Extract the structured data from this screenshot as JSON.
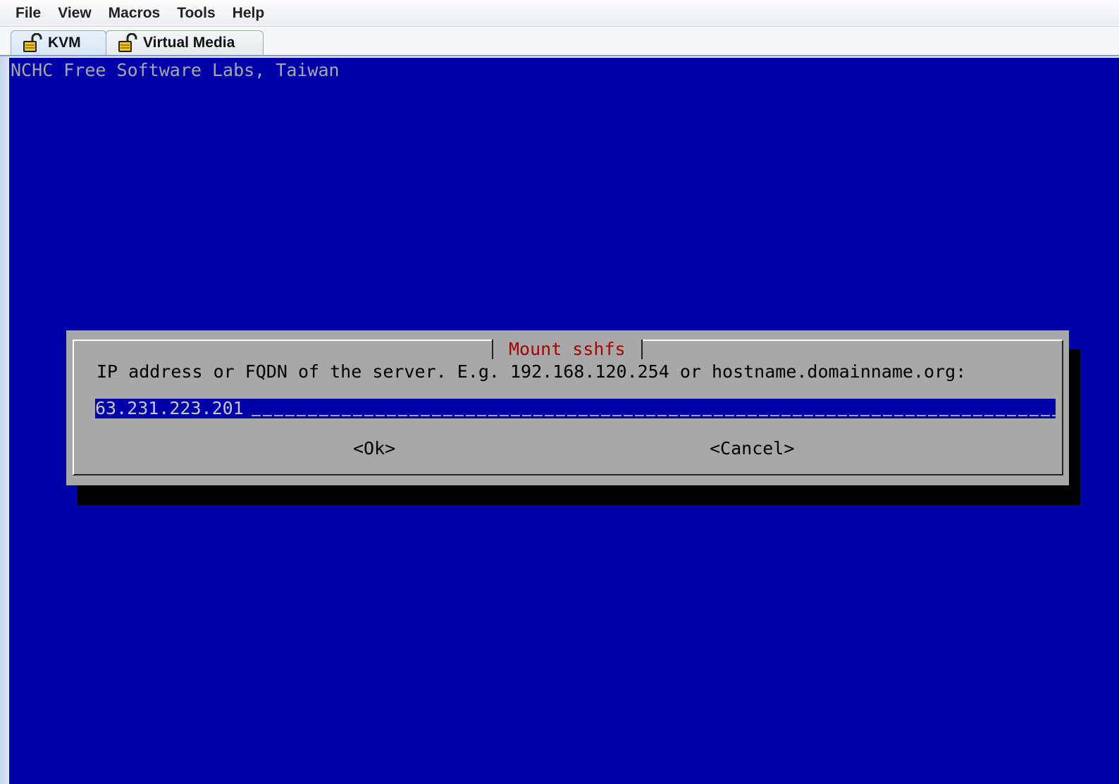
{
  "menu": {
    "items": [
      "File",
      "View",
      "Macros",
      "Tools",
      "Help"
    ]
  },
  "tabs": [
    {
      "label": "KVM",
      "icon": "unlock-icon"
    },
    {
      "label": "Virtual Media",
      "icon": "unlock-icon"
    }
  ],
  "console": {
    "backtitle": "NCHC Free Software Labs, Taiwan",
    "dialog": {
      "title": "Mount sshfs",
      "prompt": "IP address or FQDN of the server. E.g. 192.168.120.254 or hostname.domainname.org:",
      "input_value": "63.231.223.201",
      "ok_label": "<Ok>",
      "cancel_label": "<Cancel>"
    }
  },
  "colors": {
    "console_bg": "#0000a8",
    "dialog_bg": "#a8a8a8",
    "dialog_title": "#a80000",
    "shadow": "#000000"
  }
}
